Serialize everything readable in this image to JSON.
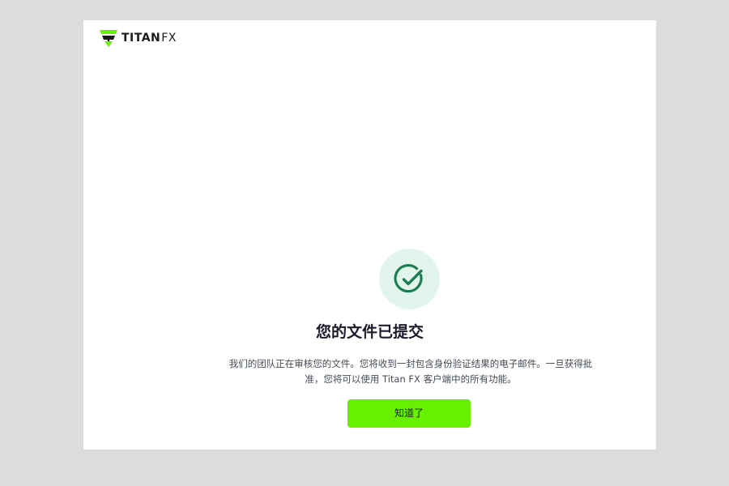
{
  "brand": {
    "logo_text_main": "TITAN",
    "logo_text_suffix": "FX",
    "logo_icon": "titan-shield-icon",
    "accent_color": "#67f000"
  },
  "status": {
    "icon": "check-circle-icon",
    "icon_color": "#1e7c53",
    "icon_bg_color": "#e2f5ec"
  },
  "dialog": {
    "title": "您的文件已提交",
    "description": "我们的团队正在审核您的文件。您将收到一封包含身份验证结果的电子邮件。一旦获得批准，您将可以使用 Titan FX 客户端中的所有功能。",
    "button_label": "知道了"
  }
}
